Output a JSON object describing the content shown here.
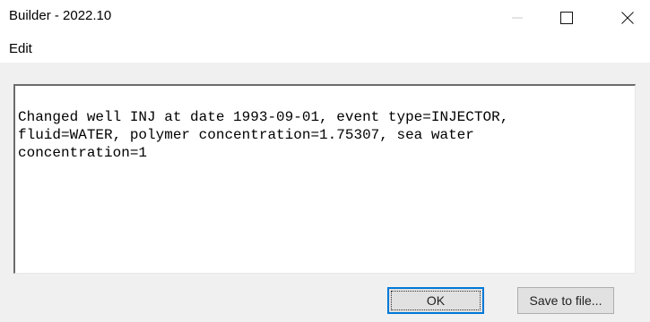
{
  "window": {
    "title": "Builder - 2022.10",
    "controls": {
      "minimize_icon": "minimize-icon",
      "maximize_icon": "maximize-icon",
      "close_icon": "close-icon"
    }
  },
  "menu": {
    "items": [
      {
        "label": "Edit"
      }
    ]
  },
  "message": {
    "text": "Changed well INJ at date 1993-09-01, event type=INJECTOR,\nfluid=WATER, polymer concentration=1.75307, sea water\nconcentration=1"
  },
  "buttons": {
    "ok_label": "OK",
    "save_label": "Save to file..."
  },
  "colors": {
    "dialog_background": "#f0f0f0",
    "focus_accent": "#0078d7",
    "button_face": "#e1e1e1"
  }
}
